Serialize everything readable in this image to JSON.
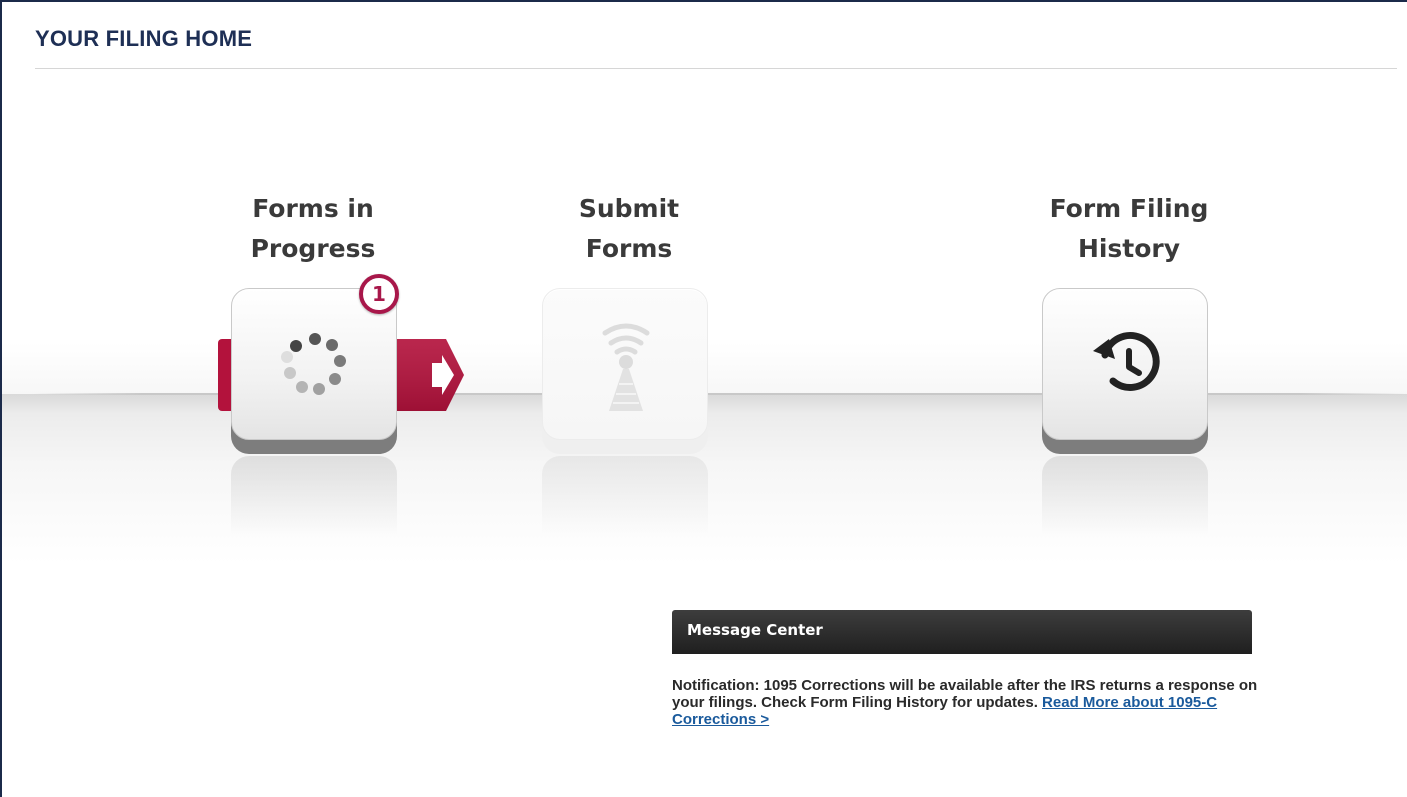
{
  "page": {
    "title": "YOUR FILING HOME"
  },
  "tiles": [
    {
      "label_line1": "Forms in",
      "label_line2": "Progress",
      "icon": "spinner-icon",
      "state": "active",
      "badge": "1"
    },
    {
      "label_line1": "Submit",
      "label_line2": "Forms",
      "icon": "antenna-icon",
      "state": "disabled"
    },
    {
      "label_line1": "Form Filing",
      "label_line2": "History",
      "icon": "history-icon",
      "state": "enabled"
    }
  ],
  "message_center": {
    "header": "Message Center",
    "notification_text": "Notification: 1095 Corrections will be available after the IRS returns a response on your filings. Check Form Filing History for updates.",
    "link_text": "Read More about 1095-C Corrections >"
  },
  "colors": {
    "title": "#1e2f55",
    "accent": "#b3123c",
    "badge": "#a8174a",
    "link": "#1a5a9c"
  }
}
